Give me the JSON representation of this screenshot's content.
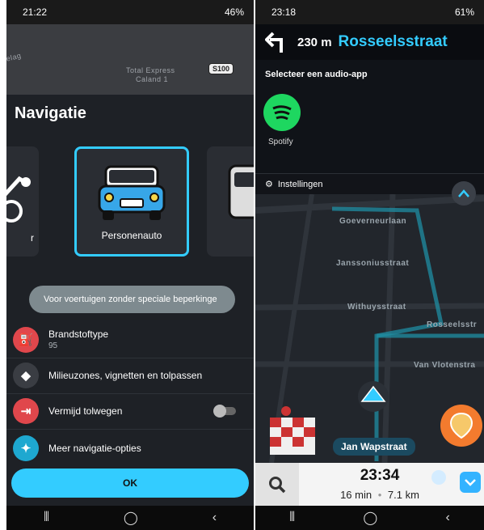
{
  "left": {
    "status": {
      "time": "21:22",
      "indicators": "46%"
    },
    "map_labels": [
      "relag",
      "Total Express",
      "Caland 1",
      "S100"
    ],
    "title": "Navigatie",
    "vehicles": {
      "prev_label": "r",
      "selected_label": "Personenauto"
    },
    "tooltip": "Voor voertuigen zonder speciale beperkinge",
    "options": [
      {
        "label": "Brandstoftype",
        "sub": "95",
        "icon": "fuel-icon",
        "color": "#e0474c"
      },
      {
        "label": "Milieuzones, vignetten en tolpassen",
        "icon": "diamond-icon",
        "color": "#3a3d43"
      },
      {
        "label": "Vermijd tolwegen",
        "icon": "toll-icon",
        "color": "#e0474c"
      },
      {
        "label": "Meer navigatie-opties",
        "icon": "star-icon",
        "color": "#1ea8d0"
      }
    ],
    "ok_label": "OK"
  },
  "right": {
    "status": {
      "time": "23:18",
      "indicators": "61%"
    },
    "turn_distance": "230 m",
    "turn_street": "Rosseelsstraat",
    "audio_title": "Selecteer een audio-app",
    "audio_app": "Spotify",
    "settings_label": "Instellingen",
    "streets": [
      "Goeverneurlaan",
      "Janssoniusstraat",
      "Withuysstraat",
      "Rosseelsstr",
      "Van Vlotenstra"
    ],
    "current_street": "Jan Wapstraat",
    "eta": "23:34",
    "duration": "16 min",
    "distance": "7.1 km"
  },
  "colors": {
    "accent": "#33ccff",
    "spotify": "#1ed760",
    "report": "#f37b2e"
  }
}
